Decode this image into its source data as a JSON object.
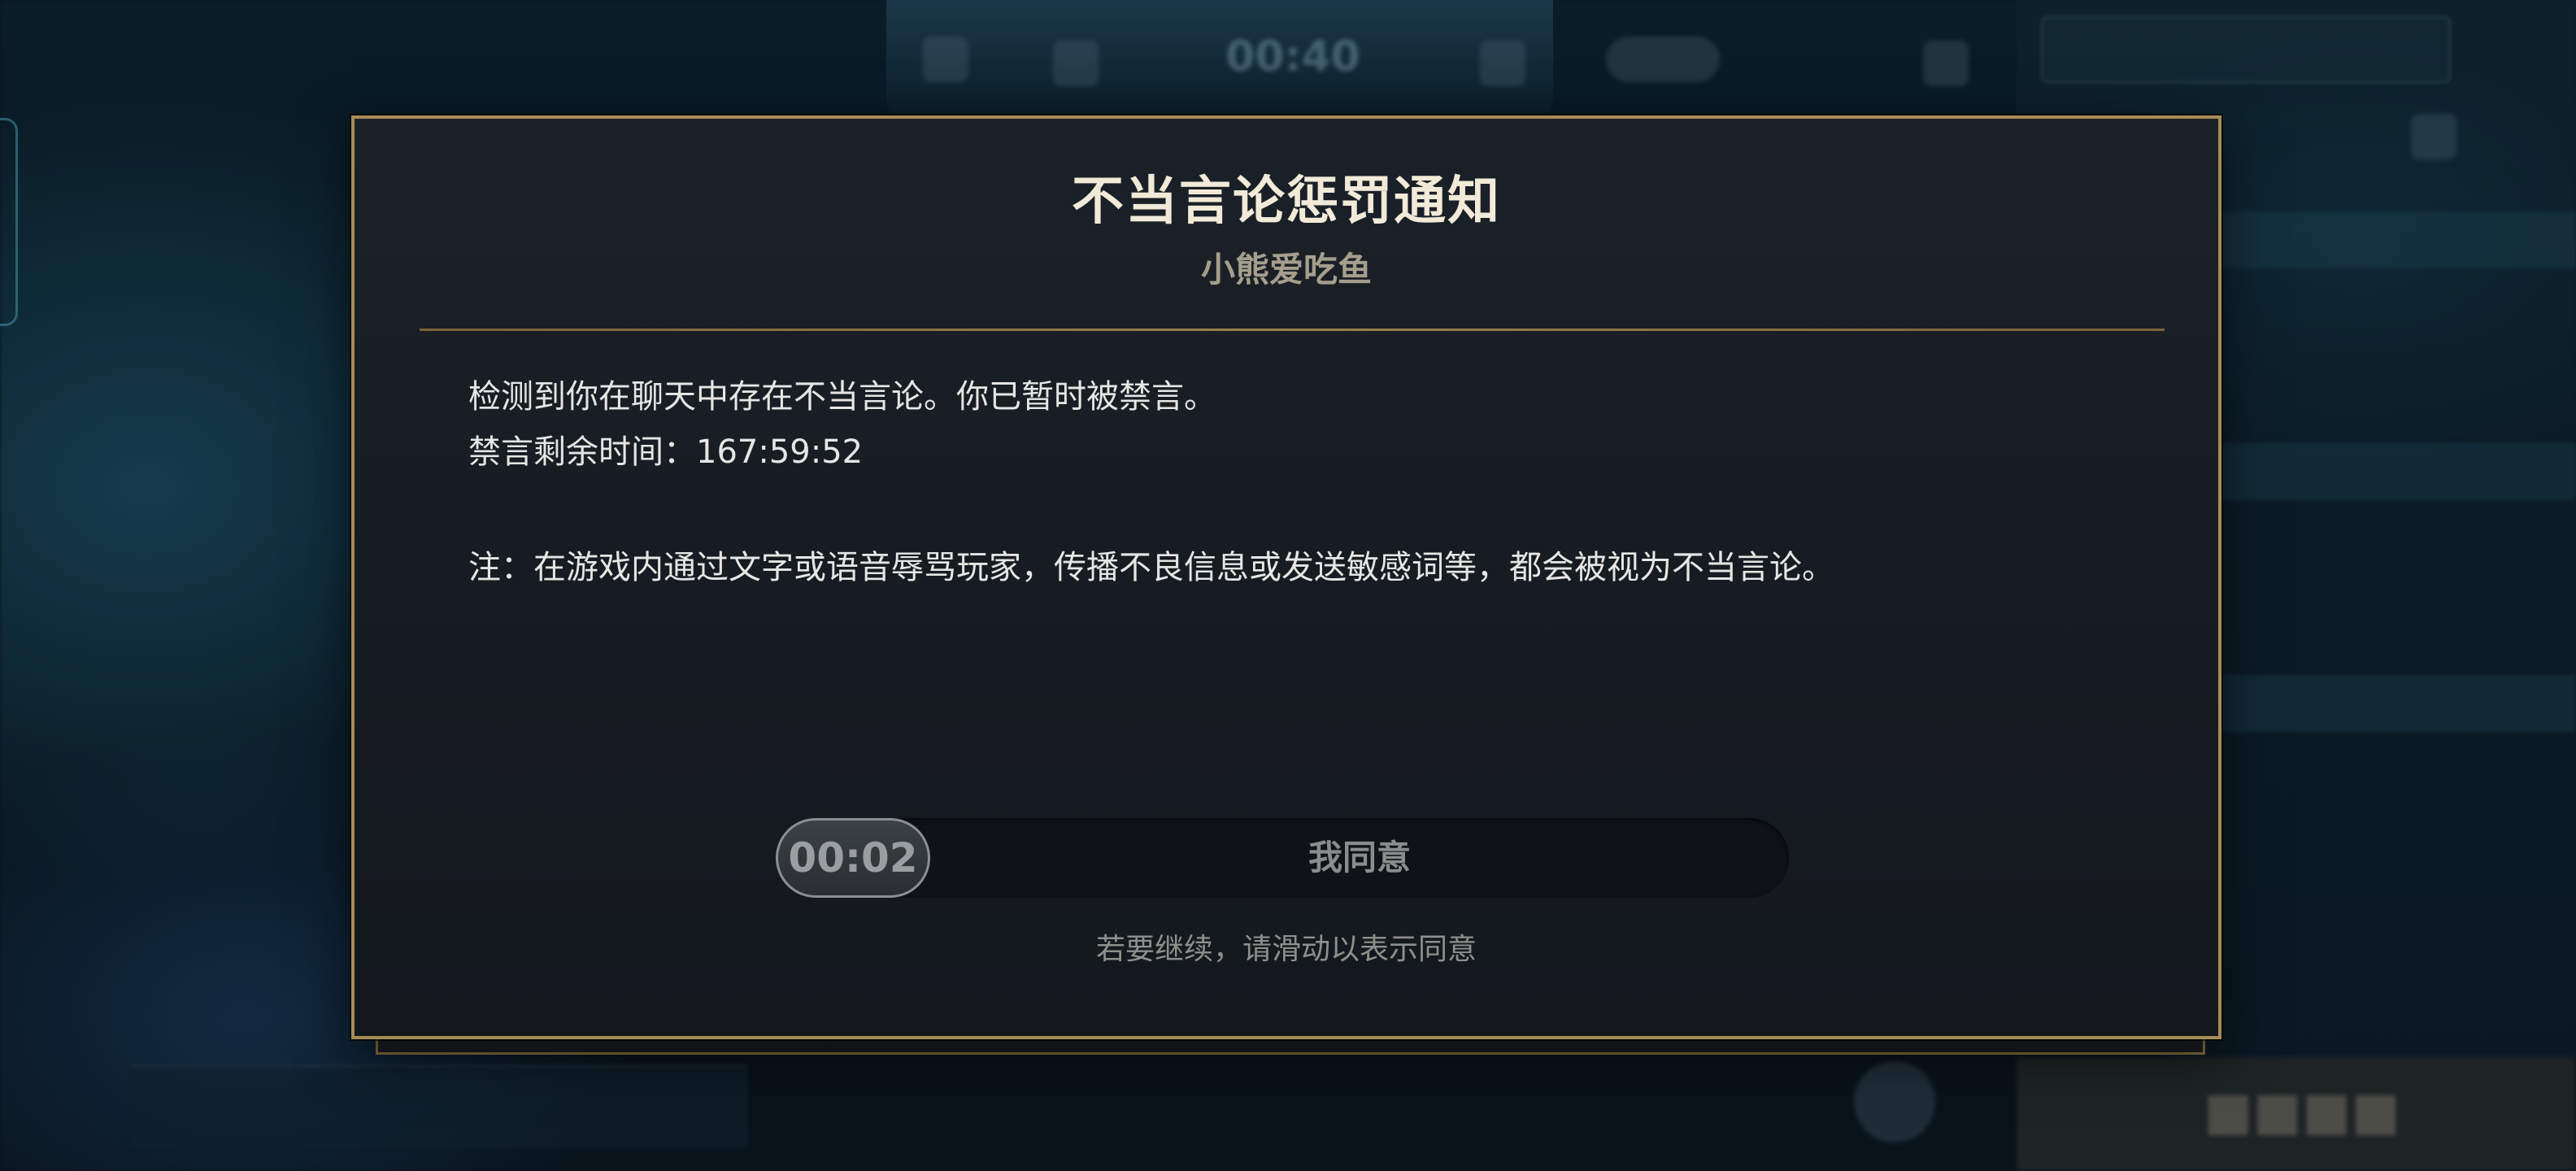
{
  "modal": {
    "title": "不当言论惩罚通知",
    "player_name": "小熊爱吃鱼",
    "message_line1": "检测到你在聊天中存在不当言论。你已暂时被禁言。",
    "ban_remaining_label": "禁言剩余时间：",
    "ban_remaining_time": "167:59:52",
    "note": "注：在游戏内通过文字或语音辱骂玩家，传播不良信息或发送敏感词等，都会被视为不当言论。",
    "slider": {
      "countdown": "00:02",
      "label": "我同意"
    },
    "hint": "若要继续，请滑动以表示同意"
  },
  "colors": {
    "frame_gold": "#a88c55",
    "modal_bg": "#1b2128",
    "title_text": "#f2ead8",
    "body_text": "#e6e6e4"
  }
}
